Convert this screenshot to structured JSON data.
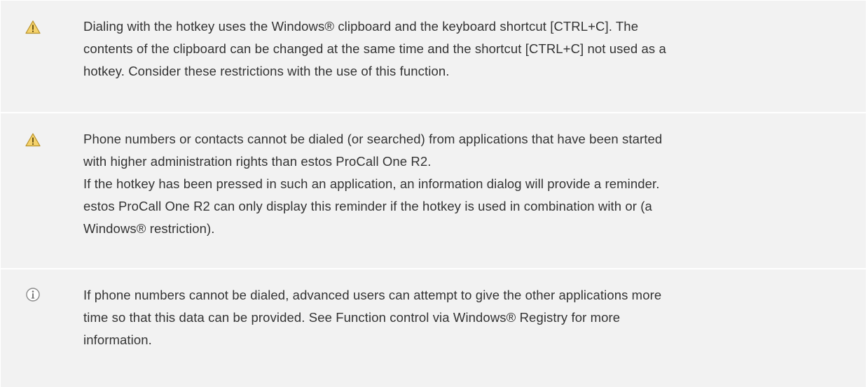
{
  "notes": [
    {
      "icon": "warning-icon",
      "lines": [
        "Dialing with the hotkey uses the Windows® clipboard and the keyboard shortcut [CTRL+C]. The",
        "contents of the clipboard can be changed at the same time and the shortcut [CTRL+C] not used as a",
        "hotkey. Consider these restrictions with the use of this function."
      ]
    },
    {
      "icon": "warning-icon",
      "lines": [
        "Phone numbers or contacts cannot be dialed (or searched) from applications that have been started",
        "with higher administration rights than estos ProCall One R2.",
        "If the hotkey has been pressed in such an application, an information dialog will provide a reminder.",
        "estos ProCall One R2 can only display this reminder if the hotkey is used in combination with or (a",
        "Windows® restriction)."
      ]
    },
    {
      "icon": "info-icon",
      "lines": [
        "If phone numbers cannot be dialed, advanced users can attempt to give the other applications more",
        "time so that this data can be provided. See Function control via Windows® Registry for more",
        "information."
      ]
    }
  ],
  "colors": {
    "panel_bg": "#f2f2f2",
    "text": "#333333",
    "warning_fill": "#f5d26b",
    "warning_stroke": "#b8922a",
    "info_stroke": "#8a8a8a"
  }
}
